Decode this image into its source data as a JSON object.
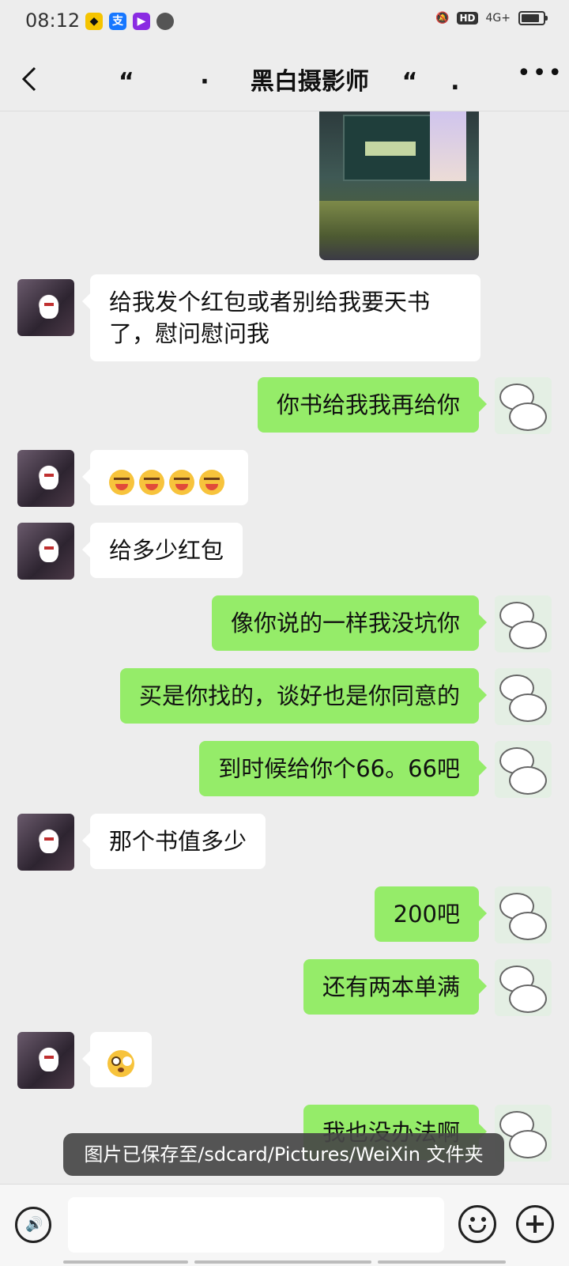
{
  "status_bar": {
    "time": "08:12",
    "hd_label": "HD",
    "network_label": "4G+"
  },
  "header": {
    "title": "“        ·     黑白摄影师    “    ."
  },
  "messages": [
    {
      "side": "left",
      "text": "给我发个红包或者别给我要天书了，慰问慰问我"
    },
    {
      "side": "right",
      "text": "你书给我我再给你"
    },
    {
      "side": "left",
      "emoji": "crying-laughing-face",
      "count": 4
    },
    {
      "side": "left",
      "text": "给多少红包"
    },
    {
      "side": "right",
      "text": "像你说的一样我没坑你"
    },
    {
      "side": "right",
      "text": "买是你找的，谈好也是你同意的"
    },
    {
      "side": "right",
      "text": "到时候给你个66。66吧"
    },
    {
      "side": "left",
      "text": "那个书值多少"
    },
    {
      "side": "right",
      "text": "200吧"
    },
    {
      "side": "right",
      "text": "还有两本单满"
    },
    {
      "side": "left",
      "emoji": "shocked-face",
      "count": 1
    },
    {
      "side": "right",
      "text": "我也没办法啊"
    }
  ],
  "toast": {
    "text": "图片已保存至/sdcard/Pictures/WeiXin 文件夹"
  }
}
